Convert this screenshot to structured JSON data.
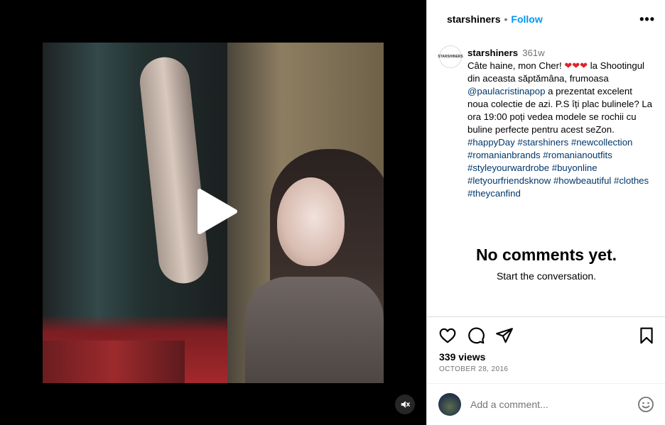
{
  "post": {
    "username": "starshiners",
    "follow_label": "Follow",
    "more_label": "•••",
    "avatar_text": "STARSHINERS"
  },
  "caption": {
    "username": "starshiners",
    "time": "361w",
    "text_1": "Câte haine, mon Cher!",
    "hearts": "❤❤❤",
    "text_2": "la Shootingul din aceasta săptămâna, frumoasa",
    "mention": "@paulacristinapop",
    "text_3": "a prezentat excelent noua colectie de azi. P.S îți plac bulinele? La ora 19:00 poți vedea modele se rochii cu buline perfecte pentru acest seZon.",
    "hashtags": "#happyDay #starshiners #newcollection #romanianbrands #romanianoutfits #styleyourwardrobe #buyonline #letyourfriendsknow #howbeautiful #clothes #theycanfind"
  },
  "comments": {
    "empty_title": "No comments yet.",
    "empty_subtitle": "Start the conversation."
  },
  "stats": {
    "views": "339 views",
    "date": "OCTOBER 28, 2016"
  },
  "comment_box": {
    "placeholder": "Add a comment..."
  },
  "icons": {
    "play": "play-icon",
    "mute": "volume-off-icon",
    "like": "heart-icon",
    "comment": "comment-icon",
    "share": "share-icon",
    "save": "bookmark-icon",
    "emoji": "emoji-icon"
  },
  "colors": {
    "accent": "#0095f6",
    "link": "#00376b",
    "heart": "#e0242b"
  }
}
